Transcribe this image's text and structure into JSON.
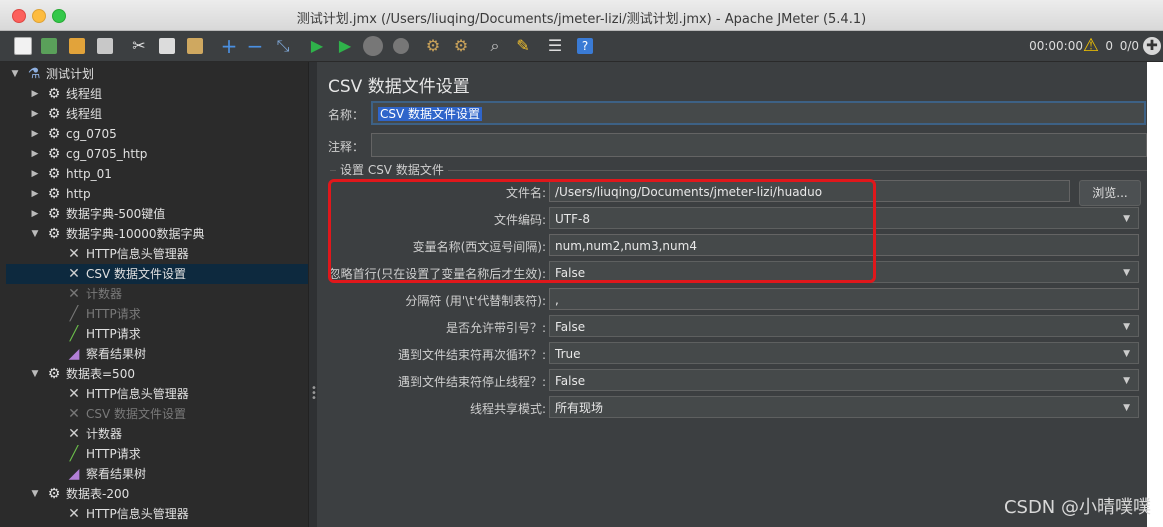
{
  "window": {
    "title": "测试计划.jmx (/Users/liuqing/Documents/jmeter-lizi/测试计划.jmx) - Apache JMeter (5.4.1)"
  },
  "toolbar": {
    "timer": "00:00:00",
    "warnings": "0",
    "threads": "0/0",
    "buttons": [
      "new",
      "templates",
      "open",
      "save",
      "cut",
      "copy",
      "paste",
      "expand",
      "collapse",
      "toggle",
      "start",
      "start-no-pause",
      "stop",
      "shutdown",
      "clear",
      "clear-all",
      "search",
      "reset-search",
      "function-helper",
      "help"
    ]
  },
  "tree": {
    "items": [
      {
        "label": "测试计划",
        "icon": "flask-icon",
        "depth": 0,
        "arrow": "▼"
      },
      {
        "label": "线程组",
        "icon": "gear-icon",
        "depth": 1,
        "arrow": "▶"
      },
      {
        "label": "线程组",
        "icon": "gear-icon",
        "depth": 1,
        "arrow": "▶"
      },
      {
        "label": "cg_0705",
        "icon": "gear-icon",
        "depth": 1,
        "arrow": "▶"
      },
      {
        "label": "cg_0705_http",
        "icon": "gear-icon",
        "depth": 1,
        "arrow": "▶"
      },
      {
        "label": "http_01",
        "icon": "gear-icon",
        "depth": 1,
        "arrow": "▶"
      },
      {
        "label": "http",
        "icon": "gear-icon",
        "depth": 1,
        "arrow": "▶"
      },
      {
        "label": "数据字典-500键值",
        "icon": "gear-icon",
        "depth": 1,
        "arrow": "▶"
      },
      {
        "label": "数据字典-10000数据字典",
        "icon": "gear-icon",
        "depth": 1,
        "arrow": "▼"
      },
      {
        "label": "HTTP信息头管理器",
        "icon": "wrench-icon",
        "depth": 2,
        "arrow": ""
      },
      {
        "label": "CSV 数据文件设置",
        "icon": "wrench-icon",
        "depth": 2,
        "arrow": "",
        "selected": true
      },
      {
        "label": "计数器",
        "icon": "wrench-icon",
        "depth": 2,
        "arrow": "",
        "disabled": true
      },
      {
        "label": "HTTP请求",
        "icon": "pipette-icon",
        "depth": 2,
        "arrow": "",
        "disabled": true
      },
      {
        "label": "HTTP请求",
        "icon": "pipette-icon",
        "depth": 2,
        "arrow": ""
      },
      {
        "label": "察看结果树",
        "icon": "chart-icon",
        "depth": 2,
        "arrow": ""
      },
      {
        "label": "数据表=500",
        "icon": "gear-icon",
        "depth": 1,
        "arrow": "▼"
      },
      {
        "label": "HTTP信息头管理器",
        "icon": "wrench-icon",
        "depth": 2,
        "arrow": ""
      },
      {
        "label": "CSV 数据文件设置",
        "icon": "wrench-icon",
        "depth": 2,
        "arrow": "",
        "disabled": true
      },
      {
        "label": "计数器",
        "icon": "wrench-icon",
        "depth": 2,
        "arrow": ""
      },
      {
        "label": "HTTP请求",
        "icon": "pipette-icon",
        "depth": 2,
        "arrow": ""
      },
      {
        "label": "察看结果树",
        "icon": "chart-icon",
        "depth": 2,
        "arrow": ""
      },
      {
        "label": "数据表-200",
        "icon": "gear-icon",
        "depth": 1,
        "arrow": "▼"
      },
      {
        "label": "HTTP信息头管理器",
        "icon": "wrench-icon",
        "depth": 2,
        "arrow": ""
      }
    ]
  },
  "panel": {
    "title": "CSV 数据文件设置",
    "name_label": "名称：",
    "name_value": "CSV 数据文件设置",
    "comment_label": "注释：",
    "comment_value": "",
    "group_title": "设置 CSV 数据文件",
    "browse_label": "浏览...",
    "rows": [
      {
        "label": "文件名:",
        "value": "/Users/liuqing/Documents/jmeter-lizi/huaduo",
        "type": "text"
      },
      {
        "label": "文件编码:",
        "value": "UTF-8",
        "type": "combo"
      },
      {
        "label": "变量名称(西文逗号间隔):",
        "value": "num,num2,num3,num4",
        "type": "text"
      },
      {
        "label": "忽略首行(只在设置了变量名称后才生效):",
        "value": "False",
        "type": "combo"
      },
      {
        "label": "分隔符 (用'\\t'代替制表符):",
        "value": ",",
        "type": "text"
      },
      {
        "label": "是否允许带引号？:",
        "value": "False",
        "type": "combo"
      },
      {
        "label": "遇到文件结束符再次循环？:",
        "value": "True",
        "type": "combo"
      },
      {
        "label": "遇到文件结束符停止线程？:",
        "value": "False",
        "type": "combo"
      },
      {
        "label": "线程共享模式:",
        "value": "所有现场",
        "type": "combo"
      }
    ]
  },
  "watermark": "CSDN @小晴噗噗",
  "colors": {
    "highlight_box": "#e0171b",
    "selection": "#0d293e"
  }
}
